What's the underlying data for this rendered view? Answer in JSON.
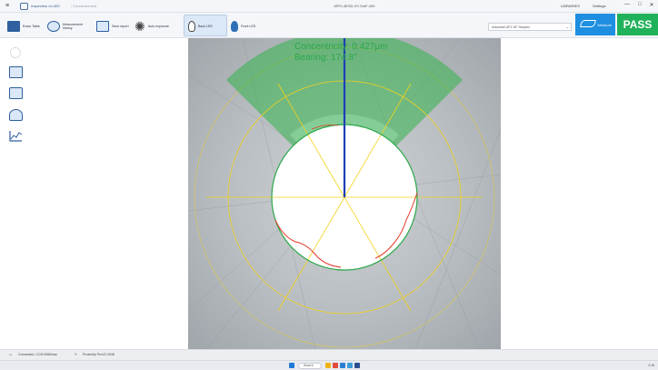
{
  "titlebar": {
    "breadcrumb": "Inspection rcl-400",
    "breadcrumb_trail": "/ Connectorized",
    "window_title": "MPO-4ESD-XY-SmF-400",
    "library_label": "LIBRARIES",
    "settings_label": "Settings",
    "minimize": "—",
    "maximize": "□",
    "close": "✕"
  },
  "toolbar": {
    "items": [
      {
        "label": "Exam Table",
        "icon": "fiber-icon"
      },
      {
        "label": "Measurement history",
        "icon": "history-icon"
      },
      {
        "label": "Save report",
        "icon": "report-icon"
      },
      {
        "label": "Auto exposure",
        "icon": "sun-icon"
      },
      {
        "label": "Back LED",
        "icon": "bulb-off-icon"
      },
      {
        "label": "Front LED",
        "icon": "bulb-on-icon"
      }
    ],
    "profile_select": "Industrial UPC 8F Simplex",
    "measure_label": "Measure",
    "result": "PASS"
  },
  "sidebar": {
    "icons": [
      "gear-icon",
      "fiber-view-icon",
      "camera-icon",
      "history-icon",
      "chart-icon"
    ]
  },
  "viewer": {
    "concentricity_label": "Concentricity: 0.427μm",
    "bearing_label": "Bearing: 174.8°",
    "colors": {
      "sector": "#33b24a",
      "bearing_line": "#1d3fb5",
      "guide": "#f2d21b",
      "edge_green": "#2aa84a",
      "edge_red": "#e23b2a"
    }
  },
  "statusbar": {
    "camera": "Connected, CCM 9060msc",
    "firmware": "Proximity ProV2 2048"
  },
  "taskbar": {
    "search_placeholder": "Search",
    "time": "2:19"
  }
}
